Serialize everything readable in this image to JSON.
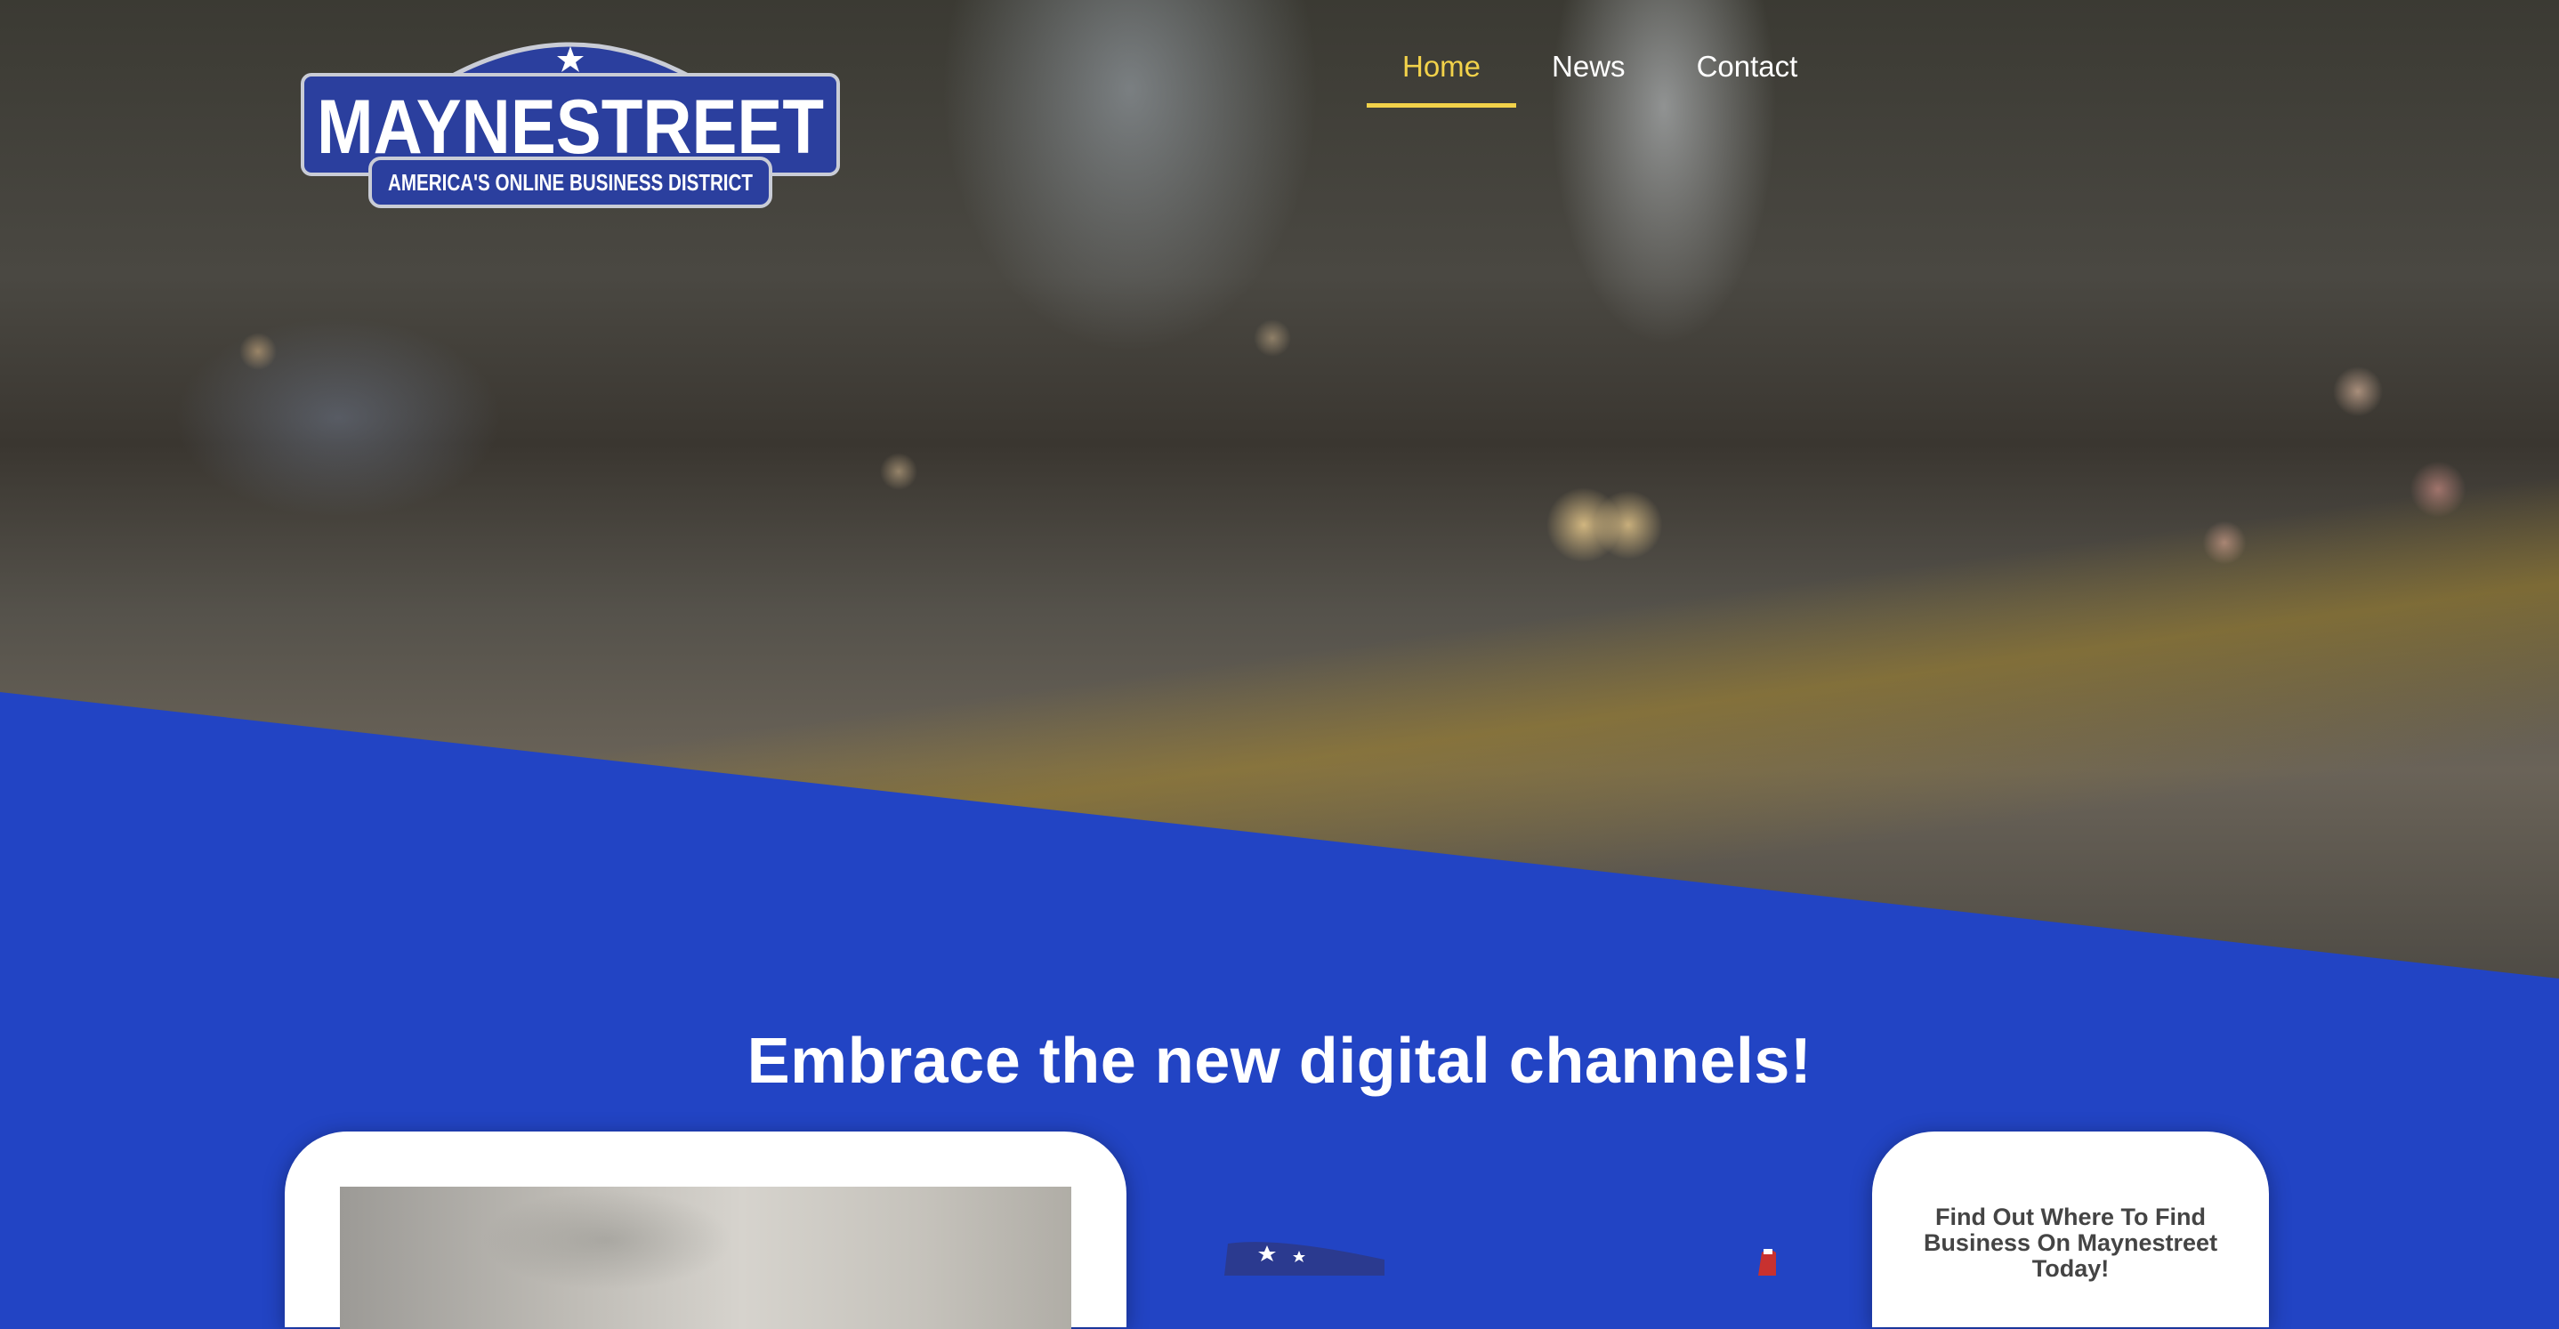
{
  "brand": {
    "name": "MAYNESTREET",
    "tagline": "AMERICA'S ONLINE BUSINESS DISTRICT",
    "color": "#2b3f9e"
  },
  "nav": {
    "items": [
      {
        "label": "Home",
        "active": true
      },
      {
        "label": "News",
        "active": false
      },
      {
        "label": "Contact",
        "active": false
      }
    ],
    "active_color": "#f2d24a"
  },
  "main": {
    "headline": "Embrace the new digital channels!",
    "background_color": "#2244c4",
    "right_card": {
      "text": "Find Out Where To Find Business On Maynestreet Today!"
    }
  }
}
